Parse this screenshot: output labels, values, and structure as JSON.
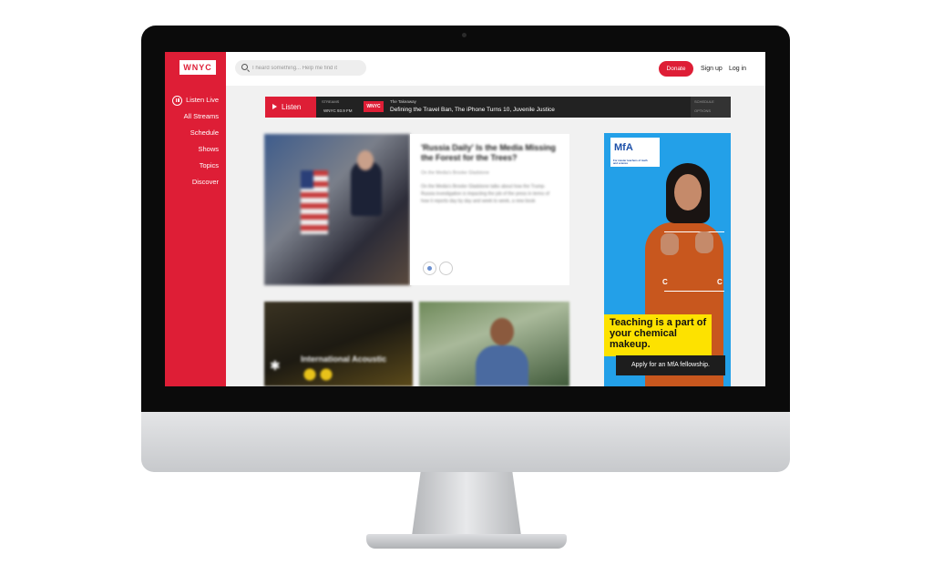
{
  "brand": {
    "logo": "WNYC",
    "accent": "#de1e36"
  },
  "sidebar": {
    "items": [
      {
        "label": "Listen Live"
      },
      {
        "label": "All Streams"
      },
      {
        "label": "Schedule"
      },
      {
        "label": "Shows"
      },
      {
        "label": "Topics"
      },
      {
        "label": "Discover"
      }
    ]
  },
  "header": {
    "search_placeholder": "I heard something... Help me find it",
    "donate_label": "Donate",
    "signup_label": "Sign up",
    "login_label": "Log in"
  },
  "listen_bar": {
    "button_label": "Listen",
    "streams_label": "STREAMS",
    "stream_value": "WNYC 93.9 FM",
    "station_logo": "WNYC",
    "show_name": "The Takeaway",
    "episode_title": "Defining the Travel Ban, The iPhone Turns 10, Juvenile Justice",
    "schedule_label": "SCHEDULE",
    "options_label": "OPTIONS"
  },
  "feature": {
    "headline": "'Russia Daily' Is the Media Missing the Forest for the Trees?",
    "byline": "On the Media's Brooke Gladstone",
    "teaser": "On the Media's Brooke Gladstone talks about how the Trump-Russia investigation is impacting the job of the press in terms of how it reports day by day and week to week, a new book"
  },
  "tiles": {
    "left_caption": "International Acoustic"
  },
  "ad": {
    "logo": "MfA",
    "logo_tagline": "For master teachers of math and science",
    "headline": "Teaching is a part of your chemical makeup.",
    "cta": "Apply for an MfA fellowship.",
    "background": "#23a0e8",
    "highlight": "#fde200"
  }
}
